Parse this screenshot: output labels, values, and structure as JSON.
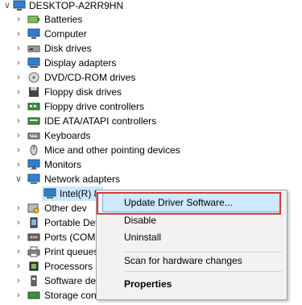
{
  "tree": {
    "root": "DESKTOP-A2RR9HN",
    "items": [
      {
        "label": "Batteries",
        "icon": "battery-icon"
      },
      {
        "label": "Computer",
        "icon": "computer-icon"
      },
      {
        "label": "Disk drives",
        "icon": "disk-drive-icon"
      },
      {
        "label": "Display adapters",
        "icon": "display-adapter-icon"
      },
      {
        "label": "DVD/CD-ROM drives",
        "icon": "dvd-drive-icon"
      },
      {
        "label": "Floppy disk drives",
        "icon": "floppy-disk-icon"
      },
      {
        "label": "Floppy drive controllers",
        "icon": "floppy-controller-icon"
      },
      {
        "label": "IDE ATA/ATAPI controllers",
        "icon": "ide-controller-icon"
      },
      {
        "label": "Keyboards",
        "icon": "keyboard-icon"
      },
      {
        "label": "Mice and other pointing devices",
        "icon": "mouse-icon"
      },
      {
        "label": "Monitors",
        "icon": "monitor-icon"
      },
      {
        "label": "Network adapters",
        "icon": "network-adapter-icon"
      },
      {
        "label": "Intel(R) 8",
        "icon": "network-card-icon"
      },
      {
        "label": "Other dev",
        "icon": "other-devices-icon"
      },
      {
        "label": "Portable Dev",
        "icon": "portable-device-icon"
      },
      {
        "label": "Ports (COM",
        "icon": "port-icon"
      },
      {
        "label": "Print queues",
        "icon": "printer-icon"
      },
      {
        "label": "Processors",
        "icon": "processor-icon"
      },
      {
        "label": "Software dev",
        "icon": "software-device-icon"
      },
      {
        "label": "Storage controllers",
        "icon": "storage-controller-icon"
      }
    ]
  },
  "context_menu": {
    "update": "Update Driver Software...",
    "disable": "Disable",
    "uninstall": "Uninstall",
    "scan": "Scan for hardware changes",
    "properties": "Properties"
  },
  "colors": {
    "highlight": "#cde8ff",
    "annotation": "#d9383a",
    "icon_blue": "#2f7fd1"
  }
}
